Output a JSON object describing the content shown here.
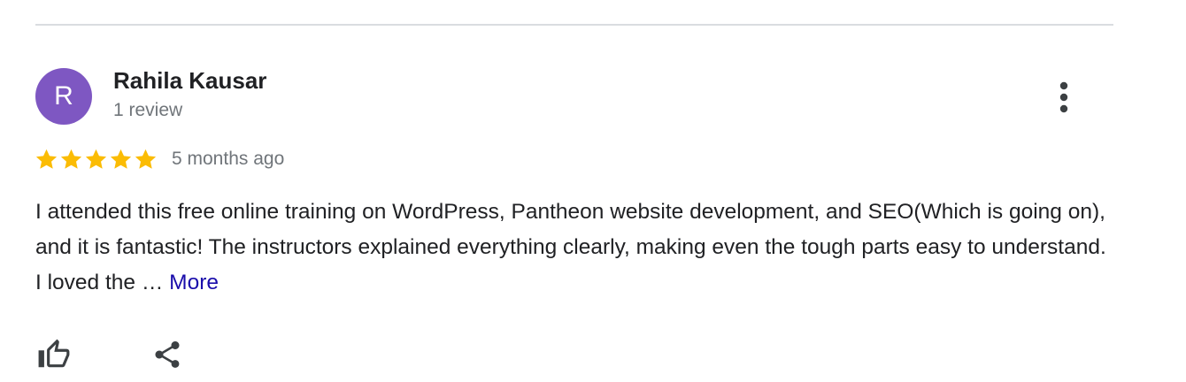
{
  "review": {
    "avatar_letter": "R",
    "avatar_color": "#7e57c2",
    "reviewer_name": "Rahila Kausar",
    "review_count": "1 review",
    "rating": 5,
    "rating_max": 5,
    "star_color": "#fbbc04",
    "time_ago": "5 months ago",
    "text": "I attended this free online training on WordPress, Pantheon website development, and SEO(Which is going on), and it is fantastic! The instructors explained everything clearly, making even the tough parts easy to understand. I loved the … ",
    "more_label": "More"
  },
  "actions": {
    "menu_icon": "more-vert-icon",
    "like_icon": "thumb-up-icon",
    "share_icon": "share-icon"
  }
}
